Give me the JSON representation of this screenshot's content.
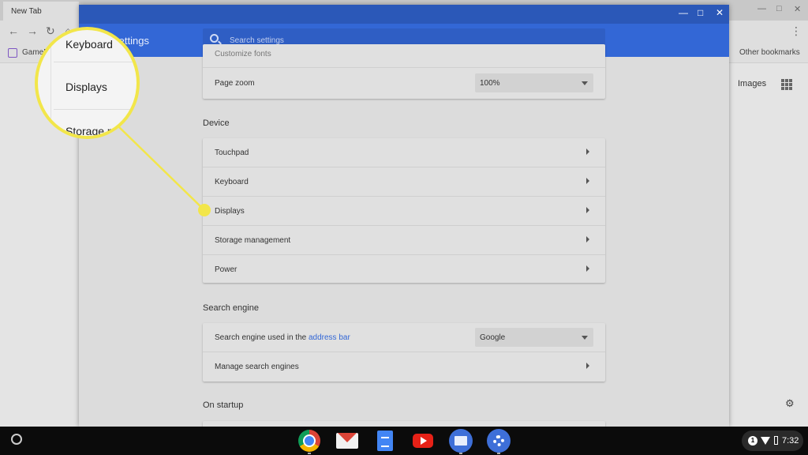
{
  "browser": {
    "tab_title": "New Tab",
    "bookmark": "GameF",
    "other_bookmarks": "Other bookmarks",
    "images_link": "Images",
    "nav_icons": [
      "back-arrow-icon",
      "forward-arrow-icon",
      "reload-icon",
      "home-icon"
    ]
  },
  "settings": {
    "title": "Settings",
    "search_placeholder": "Search settings",
    "partial_row": "Customize fonts",
    "page_zoom": {
      "label": "Page zoom",
      "value": "100%"
    },
    "device": {
      "title": "Device",
      "items": [
        "Touchpad",
        "Keyboard",
        "Displays",
        "Storage management",
        "Power"
      ]
    },
    "search_engine": {
      "title": "Search engine",
      "used_label_prefix": "Search engine used in the ",
      "used_label_link": "address bar",
      "used_value": "Google",
      "manage_label": "Manage search engines"
    },
    "on_startup": {
      "title": "On startup"
    }
  },
  "callout": {
    "items": [
      "Keyboard",
      "Displays",
      "Storage m"
    ],
    "highlight_color": "#f2e64a"
  },
  "shelf": {
    "apps": [
      "chrome-icon",
      "gmail-icon",
      "docs-icon",
      "youtube-icon",
      "files-icon",
      "settings-icon"
    ],
    "notification_count": "1",
    "time": "7:32"
  },
  "colors": {
    "header_blue": "#3367d6",
    "titlebar_blue": "#2b58b8",
    "link_blue": "#3367d6"
  }
}
